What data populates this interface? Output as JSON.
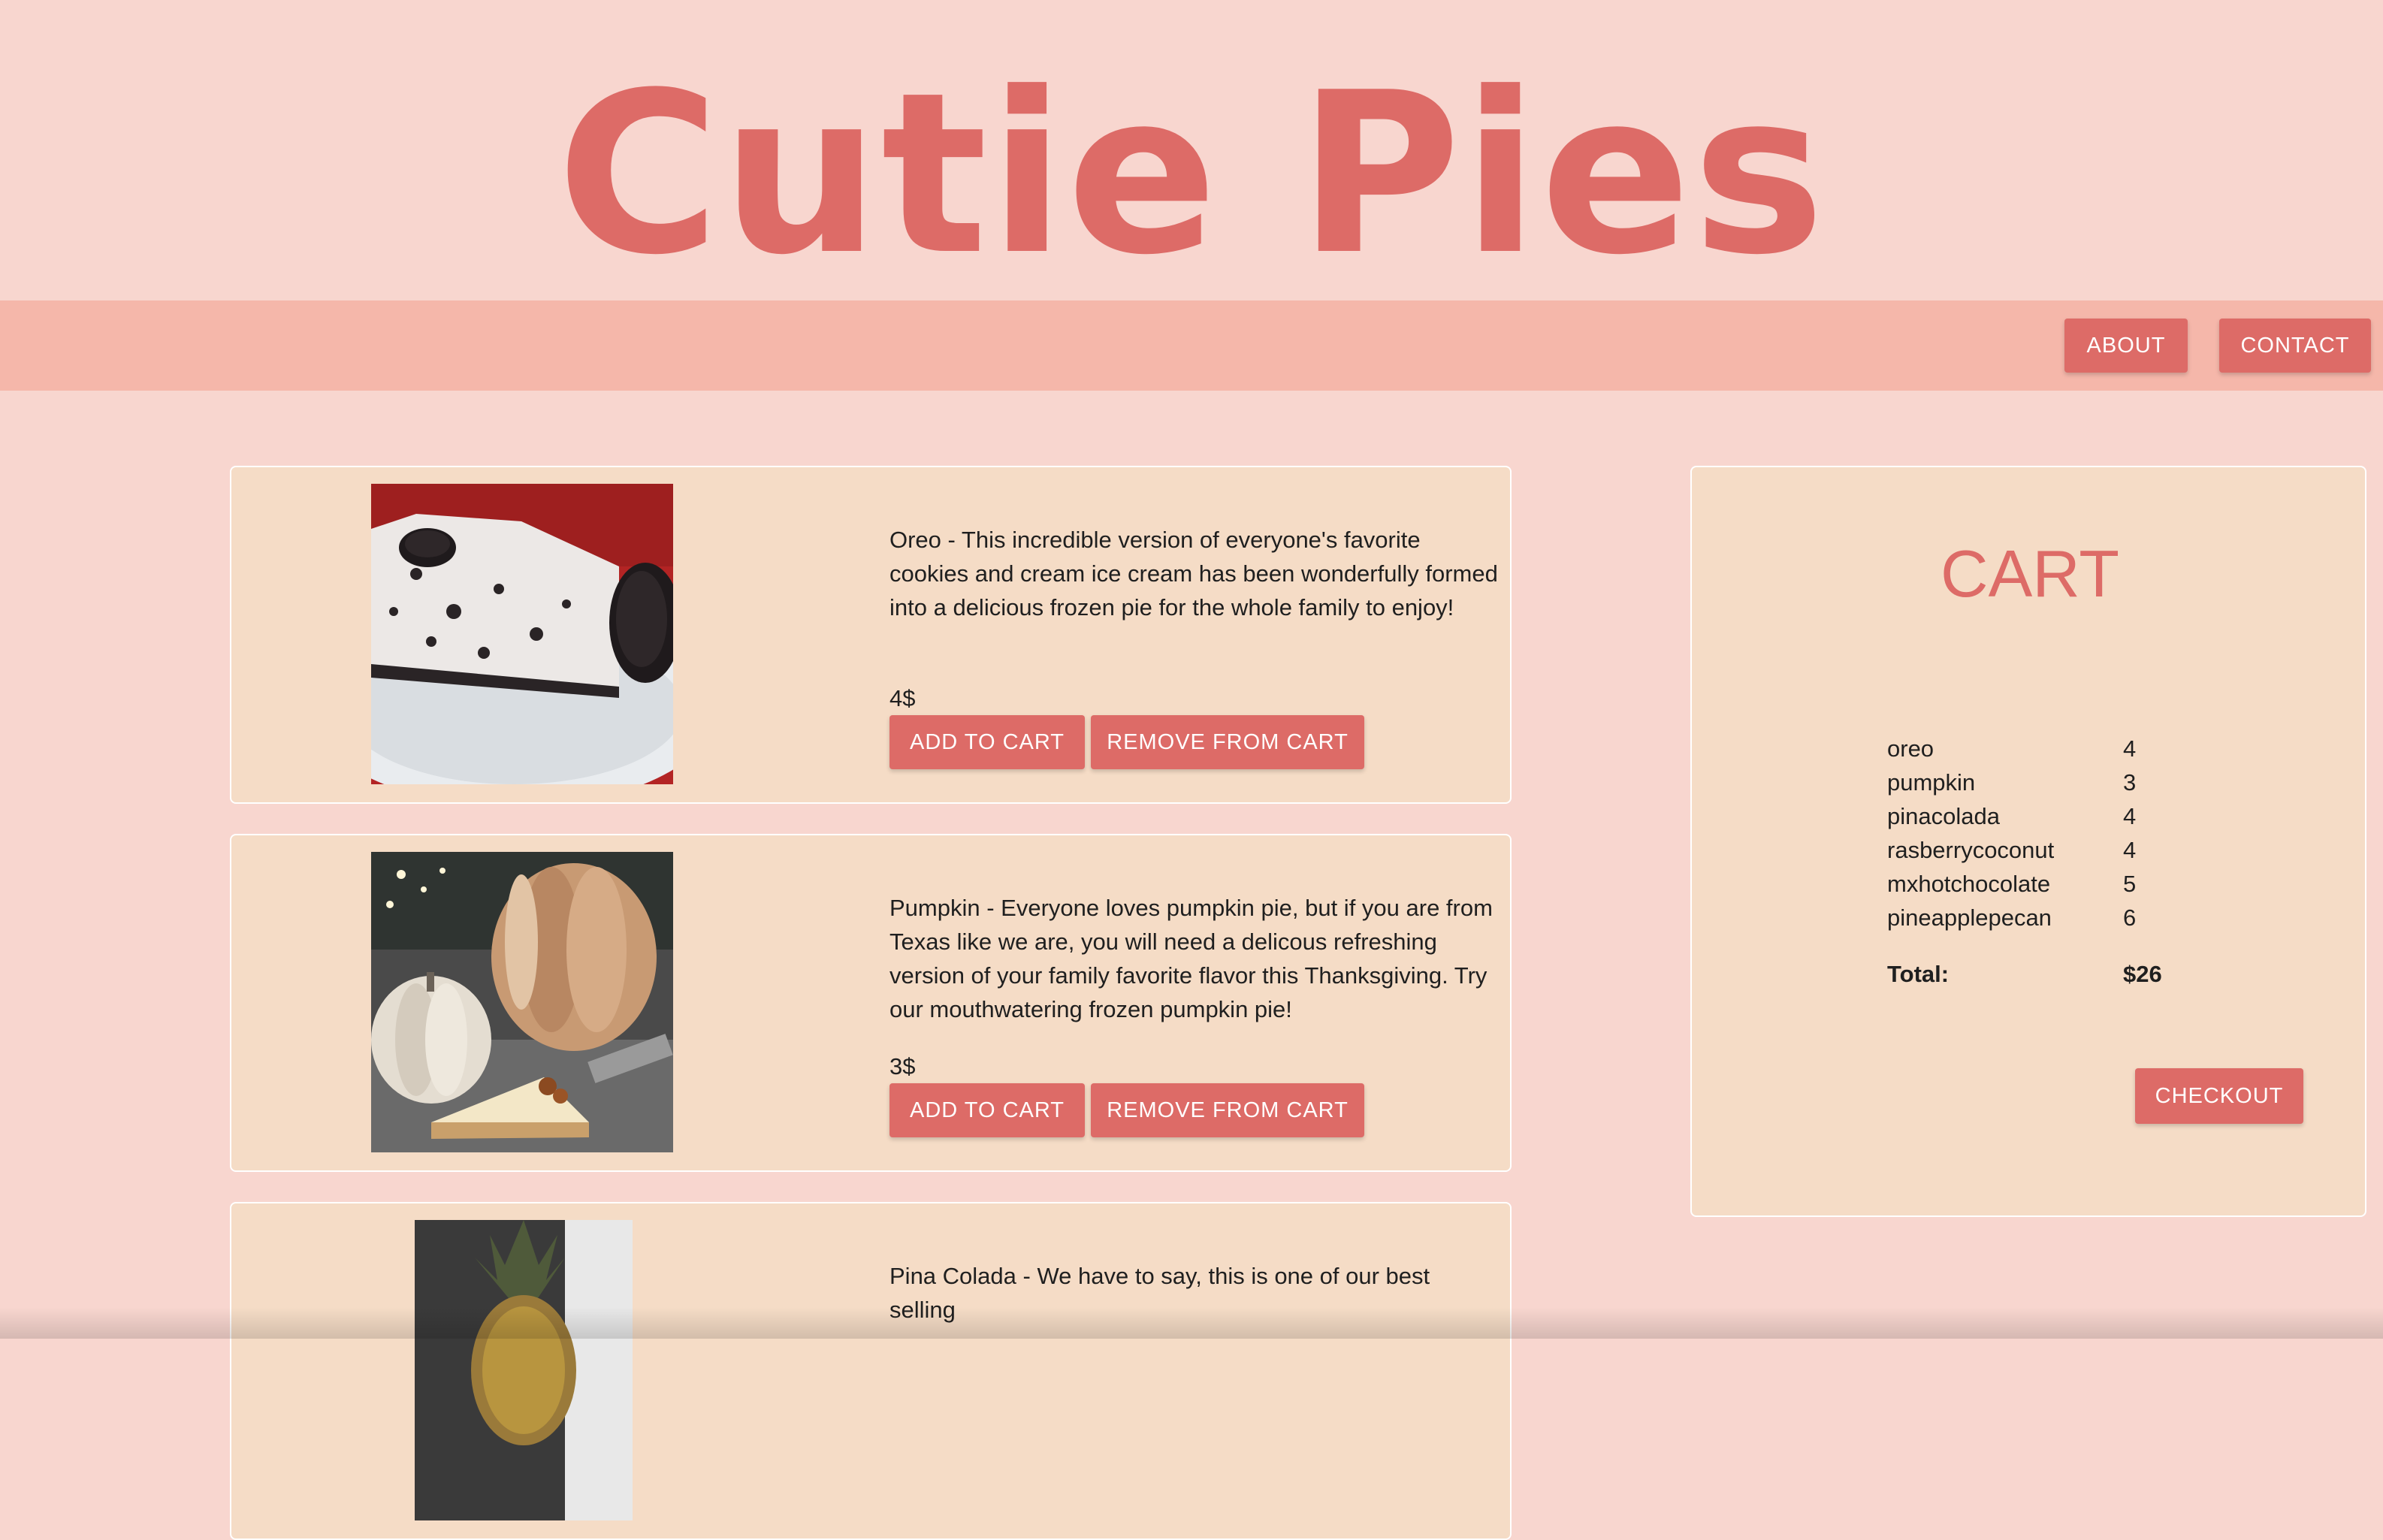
{
  "header": {
    "title": "Cutie Pies"
  },
  "nav": {
    "about_label": "ABOUT",
    "contact_label": "CONTACT"
  },
  "products": [
    {
      "description": "Oreo - This incredible version of everyone's favorite cookies and cream ice cream has been wonderfully formed into a delicious frozen pie for the whole family to enjoy!",
      "price": "4$",
      "add_label": "ADD TO CART",
      "remove_label": "REMOVE FROM CART"
    },
    {
      "description": "Pumpkin - Everyone loves pumpkin pie, but if you are from Texas like we are, you will need a delicous refreshing version of your family favorite flavor this Thanksgiving. Try our mouthwatering frozen pumpkin pie!",
      "price": "3$",
      "add_label": "ADD TO CART",
      "remove_label": "REMOVE FROM CART"
    },
    {
      "description": "Pina Colada - We have to say, this is one of our best selling"
    }
  ],
  "cart": {
    "title": "CART",
    "items": [
      {
        "name": "oreo",
        "qty": "4"
      },
      {
        "name": "pumpkin",
        "qty": "3"
      },
      {
        "name": "pinacolada",
        "qty": "4"
      },
      {
        "name": "rasberrycoconut",
        "qty": "4"
      },
      {
        "name": "mxhotchocolate",
        "qty": "5"
      },
      {
        "name": "pineapplepecan",
        "qty": "6"
      }
    ],
    "total_label": "Total:",
    "total_value": "$26",
    "checkout_label": "CHECKOUT"
  },
  "colors": {
    "background": "#f8d6cf",
    "accent": "#dd6b67",
    "navbar": "#f5b7aa",
    "card": "#f5dcc6"
  }
}
